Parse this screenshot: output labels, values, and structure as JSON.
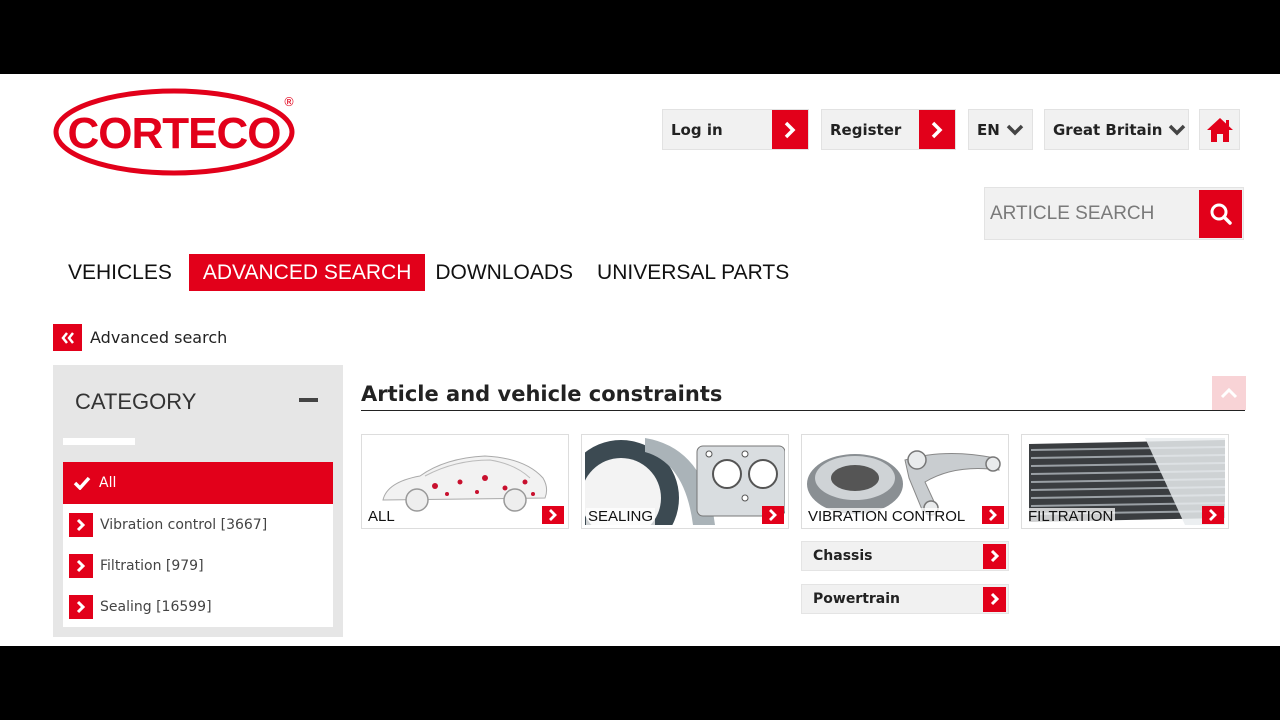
{
  "brand": {
    "name": "CORTECO",
    "mark": "®",
    "red": "#e2001a"
  },
  "header": {
    "login_label": "Log in",
    "register_label": "Register",
    "language": "EN",
    "country": "Great Britain"
  },
  "search": {
    "placeholder": "ARTICLE SEARCH"
  },
  "nav": {
    "items": [
      "VEHICLES",
      "ADVANCED SEARCH",
      "DOWNLOADS",
      "UNIVERSAL PARTS"
    ],
    "active": "ADVANCED SEARCH"
  },
  "breadcrumb": {
    "back_label": "Advanced search"
  },
  "sidebar": {
    "title": "CATEGORY",
    "categories": [
      {
        "label": "All",
        "selected": true
      },
      {
        "label": "Vibration control [3667]",
        "selected": false
      },
      {
        "label": "Filtration [979]",
        "selected": false
      },
      {
        "label": "Sealing [16599]",
        "selected": false
      }
    ]
  },
  "main": {
    "heading": "Article and vehicle constraints",
    "cards": [
      {
        "label": "ALL"
      },
      {
        "label": "SEALING"
      },
      {
        "label": "VIBRATION CONTROL"
      },
      {
        "label": "FILTRATION"
      }
    ],
    "subcategories": [
      {
        "label": "Chassis"
      },
      {
        "label": "Powertrain"
      }
    ]
  }
}
